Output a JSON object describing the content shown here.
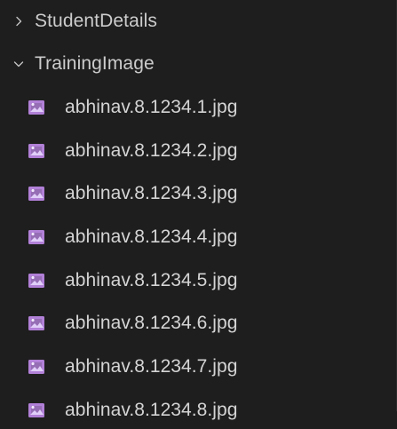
{
  "explorer": {
    "folders": [
      {
        "name": "StudentDetails",
        "state": "collapsed",
        "icon": "chevron-right-icon"
      },
      {
        "name": "TrainingImage",
        "state": "expanded",
        "icon": "chevron-down-icon"
      }
    ],
    "files": [
      "abhinav.8.1234.1.jpg",
      "abhinav.8.1234.2.jpg",
      "abhinav.8.1234.3.jpg",
      "abhinav.8.1234.4.jpg",
      "abhinav.8.1234.5.jpg",
      "abhinav.8.1234.6.jpg",
      "abhinav.8.1234.7.jpg",
      "abhinav.8.1234.8.jpg"
    ],
    "file_icon": "image-file-icon"
  },
  "colors": {
    "background": "#1e1e1e",
    "text": "#cccccc",
    "file_text": "#d4d4d4",
    "image_icon": "#b180d7"
  }
}
